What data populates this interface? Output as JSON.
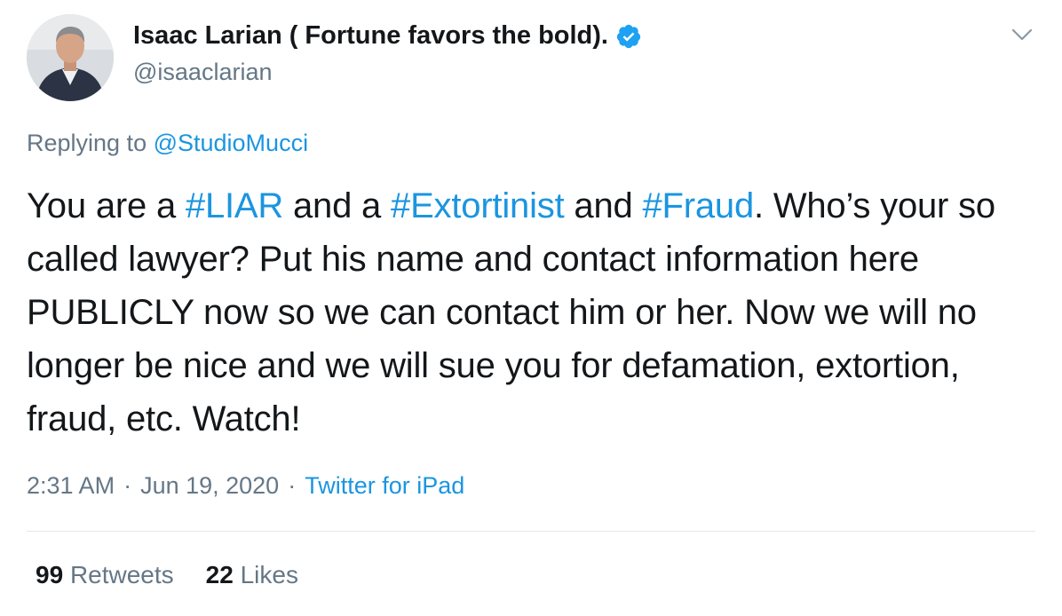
{
  "author": {
    "name": "Isaac Larian ( Fortune favors the bold).",
    "handle": "@isaaclarian",
    "verified": true
  },
  "reply": {
    "prefix": "Replying to ",
    "target": "@StudioMucci"
  },
  "tweet": {
    "t1": "You are a ",
    "h1": "#LIAR",
    "t2": " and a ",
    "h2": "#Extortinist",
    "t3": " and ",
    "h3": "#Fraud",
    "t4": ". Who’s your so called lawyer? Put his name and contact information here PUBLICLY now so we can contact him or her. Now we will no longer be nice and we will sue you for defamation, extortion, fraud, etc. Watch!"
  },
  "meta": {
    "time": "2:31 AM",
    "separator": "·",
    "date": "Jun 19, 2020",
    "source": "Twitter for iPad"
  },
  "stats": {
    "retweets_count": "99",
    "retweets_label": "Retweets",
    "likes_count": "22",
    "likes_label": "Likes"
  },
  "colors": {
    "link": "#1b95e0",
    "text": "#14171a",
    "muted": "#657786",
    "verified": "#1da1f2"
  },
  "icons": [
    "verified-badge-icon",
    "chevron-down-icon"
  ]
}
